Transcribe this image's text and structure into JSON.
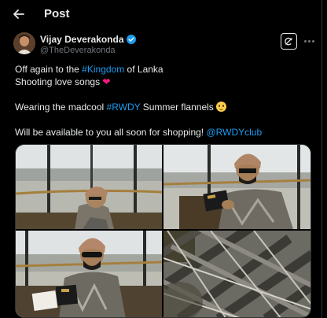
{
  "header": {
    "title": "Post",
    "back_icon": "arrow-left-icon"
  },
  "author": {
    "name": "Vijay Deverakonda",
    "handle": "@TheDeverakonda",
    "verified": true,
    "verified_color": "#1d9bf0"
  },
  "tweet": {
    "line1_prefix": "Off again to the ",
    "line1_hashtag": "#Kingdom",
    "line1_suffix": " of Lanka",
    "line2_text": "Shooting love songs ",
    "line2_emoji": "❤",
    "line3_prefix": "Wearing the madcool ",
    "line3_hashtag": "#RWDY",
    "line3_suffix": " Summer flannels ",
    "line4_text": "Will be available to you all soon for shopping! ",
    "line4_mention": "@RWDYclub"
  },
  "media": {
    "count": 4
  },
  "colors": {
    "background": "#000000",
    "text": "#e7e9ea",
    "secondary_text": "#71767b",
    "link": "#1d9bf0",
    "heart": "#f91880",
    "border": "#2f3336"
  }
}
